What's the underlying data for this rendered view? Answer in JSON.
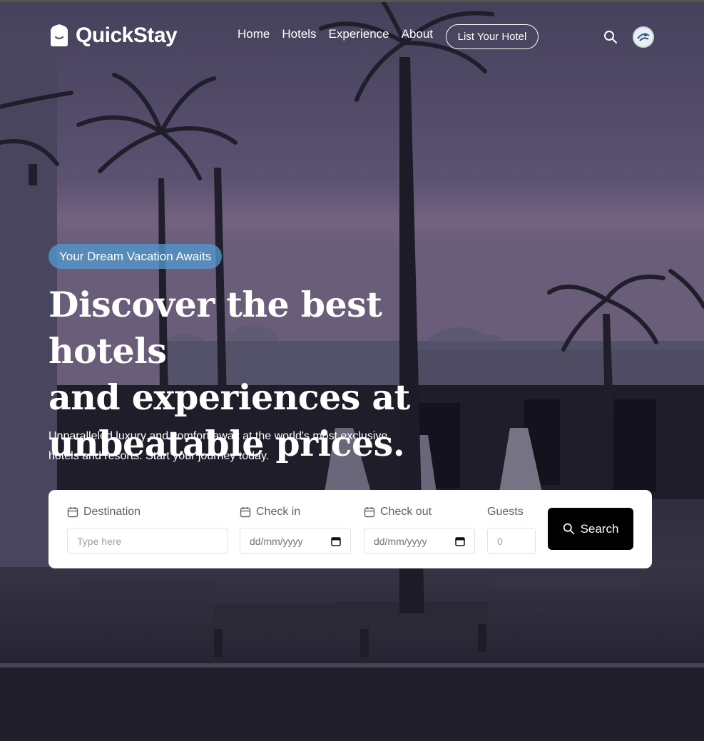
{
  "brand": {
    "name": "QuickStay"
  },
  "nav": {
    "links": [
      "Home",
      "Hotels",
      "Experience",
      "About"
    ],
    "cta_label": "List Your Hotel",
    "search_icon": "search-icon",
    "avatar_icon": "user-avatar"
  },
  "hero": {
    "badge": "Your Dream Vacation Awaits",
    "headline_lines": [
      "Discover the best hotels",
      "and experiences at",
      "unbeatable prices."
    ],
    "subtext_lines": [
      "Unparalleled luxury and comfort await at the world's most exclusive",
      "hotels and resorts. Start your journey today."
    ]
  },
  "search_form": {
    "destination": {
      "label": "Destination",
      "placeholder": "Type here"
    },
    "check_in": {
      "label": "Check in",
      "value": "dd/mm/yyyy"
    },
    "check_out": {
      "label": "Check out",
      "value": "dd/mm/yyyy"
    },
    "guests": {
      "label": "Guests",
      "value": "0"
    },
    "submit_label": "Search"
  },
  "colors": {
    "badge": "#5299cf",
    "search_button": "#000000",
    "form_background": "#ffffff"
  }
}
